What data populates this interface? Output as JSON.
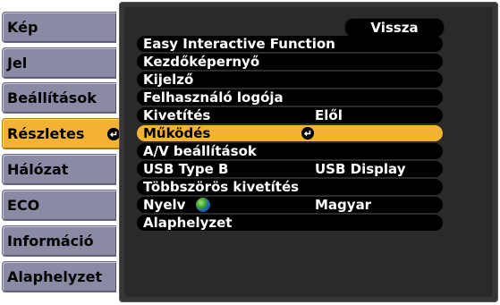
{
  "sidebar": {
    "items": [
      {
        "label": "Kép"
      },
      {
        "label": "Jel"
      },
      {
        "label": "Beállítások"
      },
      {
        "label": "Részletes"
      },
      {
        "label": "Hálózat"
      },
      {
        "label": "ECO"
      },
      {
        "label": "Információ"
      },
      {
        "label": "Alaphelyzet"
      }
    ],
    "active_index": 3
  },
  "back_button": {
    "label": "Vissza"
  },
  "menu": {
    "rows": [
      {
        "label": "Easy Interactive Function",
        "value": ""
      },
      {
        "label": "Kezdőképernyő",
        "value": ""
      },
      {
        "label": "Kijelző",
        "value": ""
      },
      {
        "label": "Felhasználó logója",
        "value": ""
      },
      {
        "label": "Kivetítés",
        "value": "Elől"
      },
      {
        "label": "Működés",
        "value": ""
      },
      {
        "label": "A/V beállítások",
        "value": ""
      },
      {
        "label": "USB Type B",
        "value": "USB Display"
      },
      {
        "label": "Többszörös kivetítés",
        "value": ""
      },
      {
        "label": "Nyelv",
        "value": "Magyar"
      },
      {
        "label": "Alaphelyzet",
        "value": ""
      }
    ],
    "selected_index": 5
  },
  "colors": {
    "sidebar_item": "#8a8aa4",
    "highlight": "#f2b233",
    "panel": "#363636",
    "row": "#000000"
  },
  "icons": {
    "enter": "enter-icon",
    "language": "globe-icon"
  }
}
